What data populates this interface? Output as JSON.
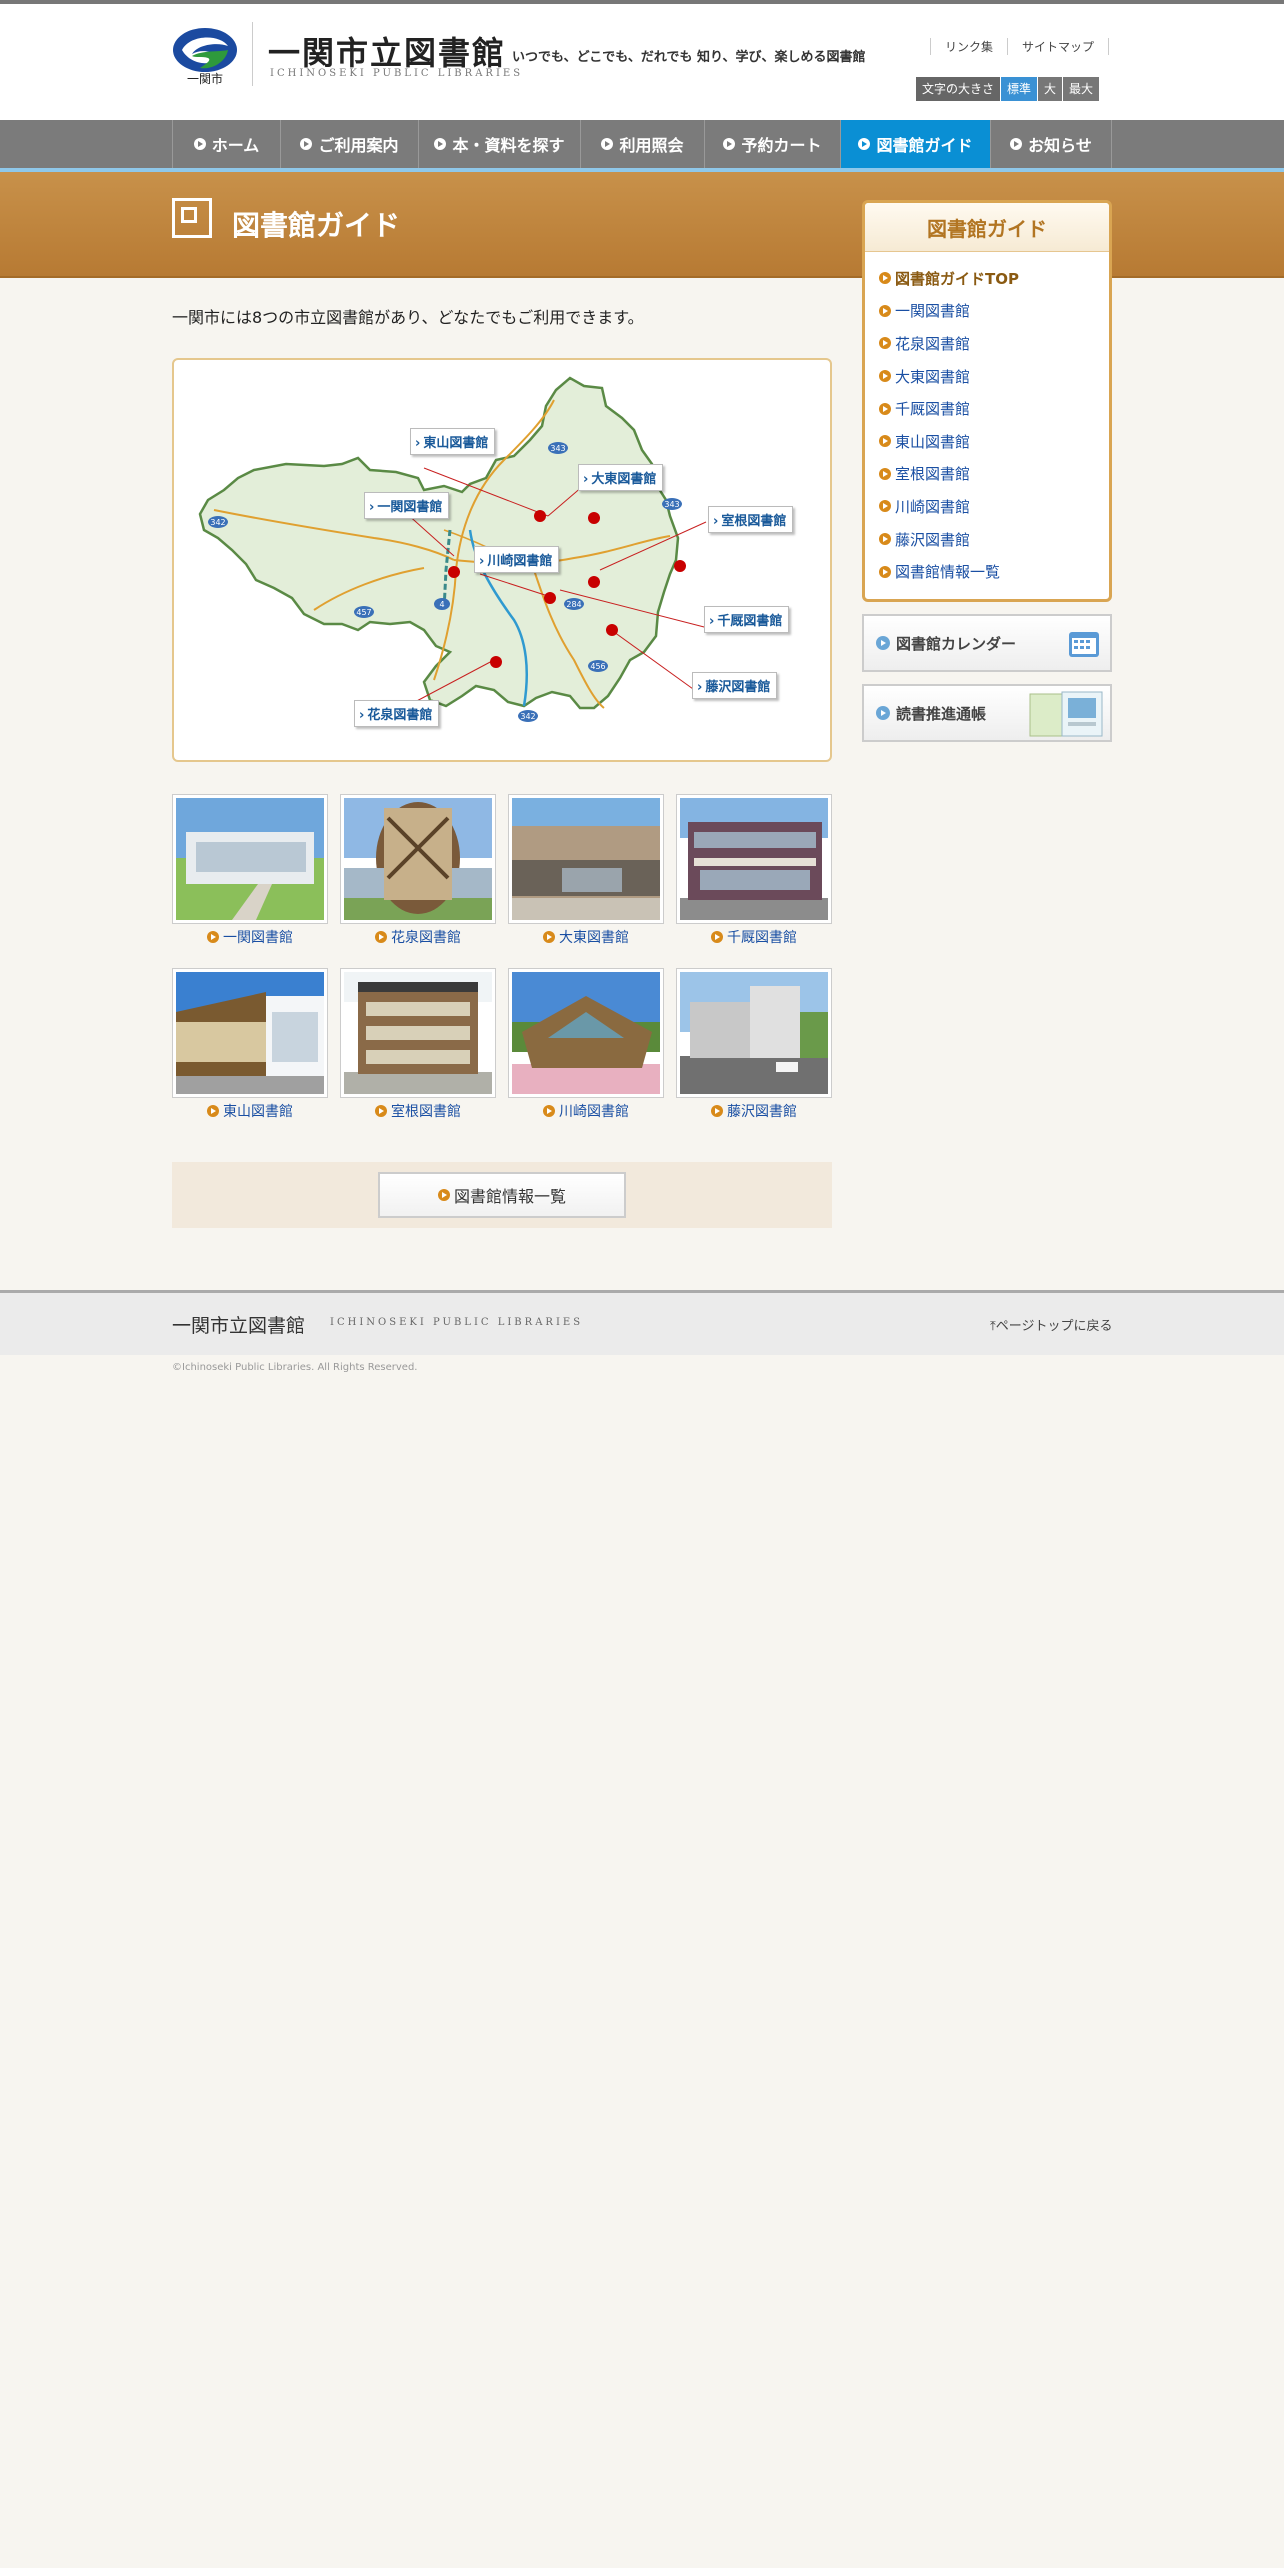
{
  "header": {
    "logo_city": "一関市",
    "title": "一関市立図書館",
    "subtitle": "ICHINOSEKI PUBLIC LIBRARIES",
    "tagline": "いつでも、どこでも、だれでも 知り、学び、楽しめる図書館",
    "links": [
      "リンク集",
      "サイトマップ"
    ],
    "font_size_label": "文字の大きさ",
    "font_size_options": [
      "標準",
      "大",
      "最大"
    ]
  },
  "nav": {
    "items": [
      "ホーム",
      "ご利用案内",
      "本・資料を探す",
      "利用照会",
      "予約カート",
      "図書館ガイド",
      "お知らせ"
    ]
  },
  "banner": {
    "title": "図書館ガイド"
  },
  "main": {
    "intro": "一関市には8つの市立図書館があり、どなたでもご利用できます。",
    "map_labels": [
      "東山図書館",
      "大東図書館",
      "一関図書館",
      "室根図書館",
      "川崎図書館",
      "千厩図書館",
      "藤沢図書館",
      "花泉図書館"
    ],
    "road_numbers": [
      "343",
      "342",
      "343",
      "4",
      "457",
      "284",
      "456",
      "342"
    ],
    "libraries": [
      "一関図書館",
      "花泉図書館",
      "大東図書館",
      "千厩図書館",
      "東山図書館",
      "室根図書館",
      "川崎図書館",
      "藤沢図書館"
    ],
    "info_button": "図書館情報一覧"
  },
  "sidebar": {
    "title": "図書館ガイド",
    "items": [
      "図書館ガイドTOP",
      "一関図書館",
      "花泉図書館",
      "大東図書館",
      "千厩図書館",
      "東山図書館",
      "室根図書館",
      "川崎図書館",
      "藤沢図書館",
      "図書館情報一覧"
    ],
    "calendar_button": "図書館カレンダー",
    "reading_button": "読書推進通帳"
  },
  "footer": {
    "title": "一関市立図書館",
    "subtitle": "ICHINOSEKI PUBLIC LIBRARIES",
    "page_top": "ページトップに戻る",
    "copyright": "©Ichinoseki Public Libraries. All Rights Reserved."
  },
  "colors": {
    "accent_orange": "#c08640",
    "nav_active": "#0a8fd4",
    "link": "#1a4fa3"
  }
}
